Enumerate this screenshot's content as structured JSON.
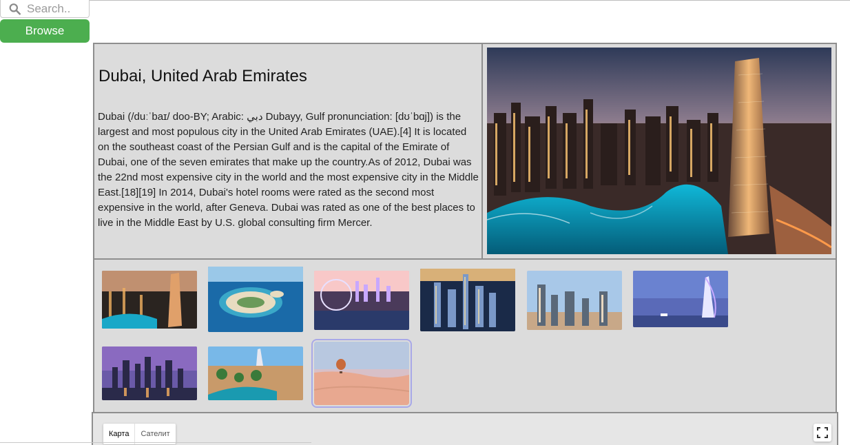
{
  "search": {
    "placeholder": "Search.."
  },
  "browse": {
    "label": "Browse"
  },
  "city": {
    "title": "Dubai, United Arab Emirates",
    "description": "Dubai (/duːˈbaɪ/ doo-BY; Arabic: دبي Dubayy, Gulf pronunciation: [dʊˈbɑj]) is the largest and most populous city in the United Arab Emirates (UAE).[4] It is located on the southeast coast of the Persian Gulf and is the capital of the Emirate of Dubai, one of the seven emirates that make up the country.As of 2012, Dubai was the 22nd most expensive city in the world and the most expensive city in the Middle East.[18][19] In 2014, Dubai's hotel rooms were rated as the second most expensive in the world, after Geneva. Dubai was rated as one of the best places to live in the Middle East by U.S. global consulting firm Mercer."
  },
  "gallery": {
    "thumbnails": [
      {
        "name": "dubai-marina-night-thumbnail"
      },
      {
        "name": "palm-island-thumbnail"
      },
      {
        "name": "ferris-wheel-island-thumbnail"
      },
      {
        "name": "skyline-aerial-night-thumbnail"
      },
      {
        "name": "downtown-towers-day-thumbnail"
      },
      {
        "name": "burj-al-arab-dusk-thumbnail"
      },
      {
        "name": "skyline-purple-dusk-thumbnail"
      },
      {
        "name": "madinat-jumeirah-thumbnail"
      },
      {
        "name": "desert-balloon-thumbnail",
        "selected": true
      }
    ]
  },
  "map": {
    "tabs": [
      {
        "label": "Карта",
        "active": true
      },
      {
        "label": "Сателит",
        "active": false
      }
    ]
  },
  "colors": {
    "browse_bg": "#4cae4f",
    "panel_bg": "#dcdcdc",
    "panel_border": "#8e8e8e"
  }
}
